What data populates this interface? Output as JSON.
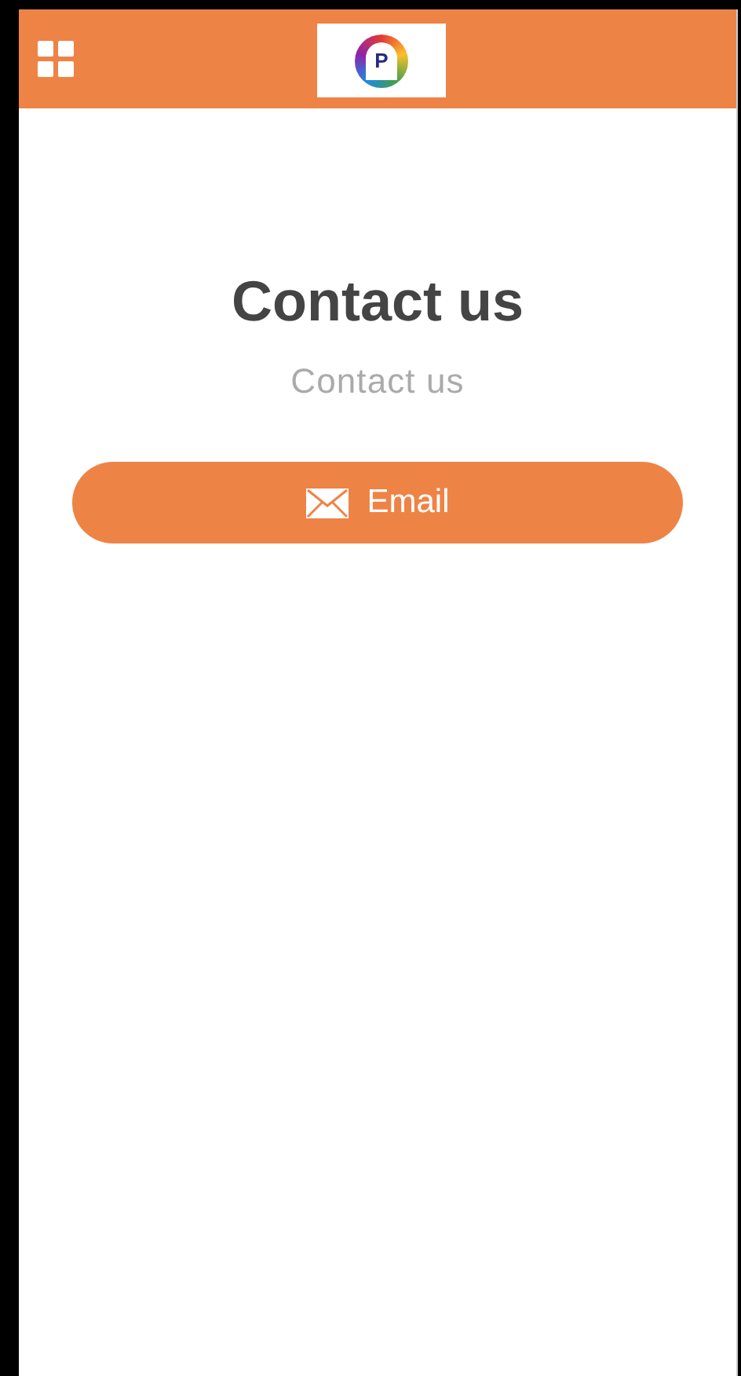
{
  "header": {
    "logo_letter": "P"
  },
  "page": {
    "title": "Contact us",
    "subtitle": "Contact us"
  },
  "buttons": [
    {
      "kind": "email",
      "label": "Email"
    }
  ]
}
